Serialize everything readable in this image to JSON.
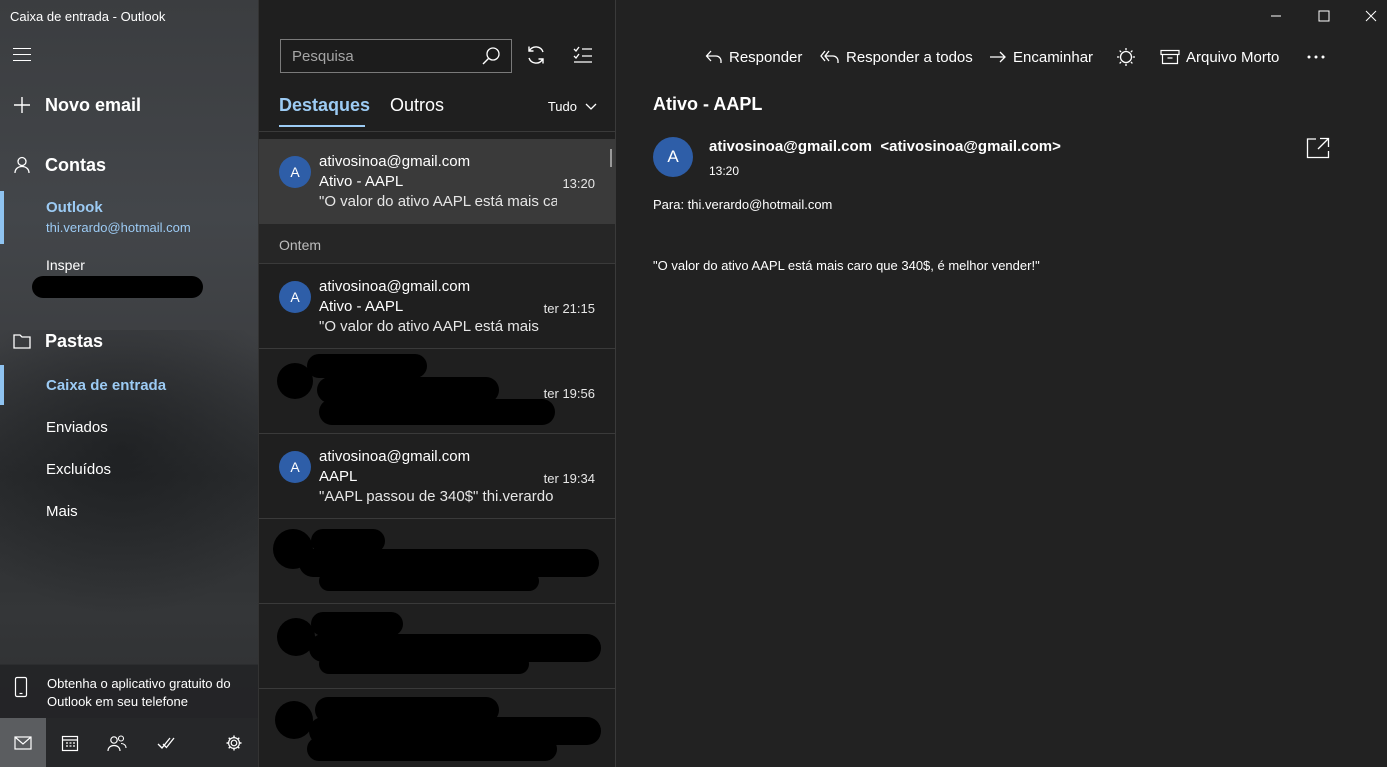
{
  "window": {
    "title": "Caixa de entrada - Outlook"
  },
  "nav": {
    "new_mail": "Novo email",
    "accounts_header": "Contas",
    "accounts": [
      {
        "name": "Outlook",
        "email": "thi.verardo@hotmail.com"
      },
      {
        "name": "Insper",
        "email": ""
      }
    ],
    "folders_header": "Pastas",
    "folders": [
      "Caixa de entrada",
      "Enviados",
      "Excluídos",
      "Mais"
    ],
    "promo": "Obtenha o aplicativo gratuito do Outlook em seu telefone"
  },
  "list": {
    "search_placeholder": "Pesquisa",
    "tabs": [
      "Destaques",
      "Outros"
    ],
    "filter": "Tudo",
    "group_yesterday": "Ontem",
    "messages": [
      {
        "from": "ativosinoa@gmail.com",
        "subject": "Ativo - AAPL",
        "preview": "\"O valor do ativo AAPL está mais caro",
        "time": "13:20",
        "avatar": "A"
      },
      {
        "from": "ativosinoa@gmail.com",
        "subject": "Ativo - AAPL",
        "preview": "\"O valor do ativo AAPL está mais",
        "time": "ter 21:15",
        "avatar": "A"
      },
      {
        "from": "",
        "subject": "",
        "preview": "",
        "time": "ter 19:56",
        "avatar": ""
      },
      {
        "from": "ativosinoa@gmail.com",
        "subject": "AAPL",
        "preview": "\"AAPL passou de 340$\" thi.verardo",
        "time": "ter 19:34",
        "avatar": "A"
      }
    ]
  },
  "reader": {
    "commands": {
      "reply": "Responder",
      "reply_all": "Responder a todos",
      "forward": "Encaminhar",
      "archive": "Arquivo Morto"
    },
    "subject": "Ativo - AAPL",
    "avatar": "A",
    "sender": "ativosinoa@gmail.com  <ativosinoa@gmail.com>",
    "time": "13:20",
    "to": "Para: thi.verardo@hotmail.com",
    "body": "\"O valor do ativo AAPL está mais caro que 340$, é melhor vender!\""
  },
  "colors": {
    "accent": "#9ccbf4",
    "avatar": "#2e5ea8",
    "selected_row": "#3a3a3a"
  }
}
